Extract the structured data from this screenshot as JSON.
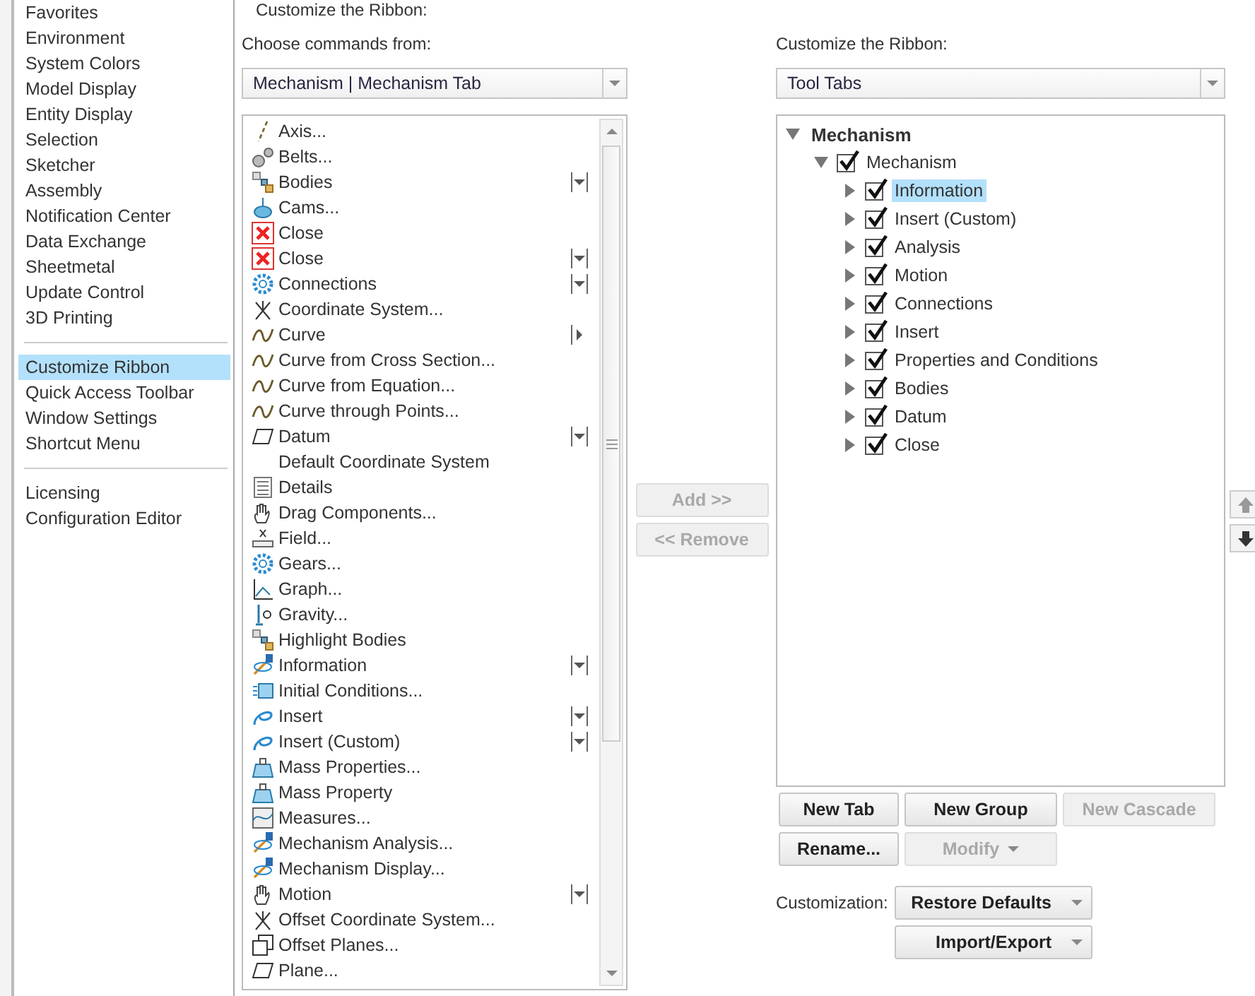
{
  "sidebar": {
    "groups": [
      {
        "items": [
          {
            "label": "Favorites",
            "selected": false
          },
          {
            "label": "Environment",
            "selected": false
          },
          {
            "label": "System Colors",
            "selected": false
          },
          {
            "label": "Model Display",
            "selected": false
          },
          {
            "label": "Entity Display",
            "selected": false
          },
          {
            "label": "Selection",
            "selected": false
          },
          {
            "label": "Sketcher",
            "selected": false
          },
          {
            "label": "Assembly",
            "selected": false
          },
          {
            "label": "Notification Center",
            "selected": false
          },
          {
            "label": "Data Exchange",
            "selected": false
          },
          {
            "label": "Sheetmetal",
            "selected": false
          },
          {
            "label": "Update Control",
            "selected": false
          },
          {
            "label": "3D Printing",
            "selected": false
          }
        ]
      },
      {
        "items": [
          {
            "label": "Customize Ribbon",
            "selected": true
          },
          {
            "label": "Quick Access Toolbar",
            "selected": false
          },
          {
            "label": "Window Settings",
            "selected": false
          },
          {
            "label": "Shortcut Menu",
            "selected": false
          }
        ]
      },
      {
        "items": [
          {
            "label": "Licensing",
            "selected": false
          },
          {
            "label": "Configuration Editor",
            "selected": false
          }
        ]
      }
    ]
  },
  "page_title": "Customize the Ribbon:",
  "commands": {
    "label": "Choose commands from:",
    "source": "Mechanism | Mechanism Tab",
    "items": [
      {
        "label": "Axis...",
        "dropdown": false,
        "cascade": false
      },
      {
        "label": "Belts...",
        "dropdown": false,
        "cascade": false
      },
      {
        "label": "Bodies",
        "dropdown": true,
        "cascade": false
      },
      {
        "label": "Cams...",
        "dropdown": false,
        "cascade": false
      },
      {
        "label": "Close",
        "dropdown": false,
        "cascade": false
      },
      {
        "label": "Close",
        "dropdown": true,
        "cascade": false
      },
      {
        "label": "Connections",
        "dropdown": true,
        "cascade": false
      },
      {
        "label": "Coordinate System...",
        "dropdown": false,
        "cascade": false
      },
      {
        "label": "Curve",
        "dropdown": false,
        "cascade": true
      },
      {
        "label": "Curve from Cross Section...",
        "dropdown": false,
        "cascade": false
      },
      {
        "label": "Curve from Equation...",
        "dropdown": false,
        "cascade": false
      },
      {
        "label": "Curve through Points...",
        "dropdown": false,
        "cascade": false
      },
      {
        "label": "Datum",
        "dropdown": true,
        "cascade": false
      },
      {
        "label": "Default Coordinate System",
        "dropdown": false,
        "cascade": false
      },
      {
        "label": "Details",
        "dropdown": false,
        "cascade": false
      },
      {
        "label": "Drag Components...",
        "dropdown": false,
        "cascade": false
      },
      {
        "label": "Field...",
        "dropdown": false,
        "cascade": false
      },
      {
        "label": "Gears...",
        "dropdown": false,
        "cascade": false
      },
      {
        "label": "Graph...",
        "dropdown": false,
        "cascade": false
      },
      {
        "label": "Gravity...",
        "dropdown": false,
        "cascade": false
      },
      {
        "label": "Highlight Bodies",
        "dropdown": false,
        "cascade": false
      },
      {
        "label": "Information",
        "dropdown": true,
        "cascade": false
      },
      {
        "label": "Initial Conditions...",
        "dropdown": false,
        "cascade": false
      },
      {
        "label": "Insert",
        "dropdown": true,
        "cascade": false
      },
      {
        "label": "Insert (Custom)",
        "dropdown": true,
        "cascade": false
      },
      {
        "label": "Mass Properties...",
        "dropdown": false,
        "cascade": false
      },
      {
        "label": "Mass Property",
        "dropdown": false,
        "cascade": false
      },
      {
        "label": "Measures...",
        "dropdown": false,
        "cascade": false
      },
      {
        "label": "Mechanism Analysis...",
        "dropdown": false,
        "cascade": false
      },
      {
        "label": "Mechanism Display...",
        "dropdown": false,
        "cascade": false
      },
      {
        "label": "Motion",
        "dropdown": true,
        "cascade": false
      },
      {
        "label": "Offset Coordinate System...",
        "dropdown": false,
        "cascade": false
      },
      {
        "label": "Offset Planes...",
        "dropdown": false,
        "cascade": false
      },
      {
        "label": "Plane...",
        "dropdown": false,
        "cascade": false
      }
    ]
  },
  "transfer_buttons": [
    {
      "label": "Add >>",
      "disabled": true
    },
    {
      "label": "<< Remove",
      "disabled": true
    }
  ],
  "ribbon": {
    "label": "Customize the Ribbon:",
    "source": "Tool Tabs",
    "tree": [
      {
        "label": "Mechanism",
        "expanded": true,
        "children": [
          {
            "label": "Mechanism",
            "checked": true,
            "expanded": true,
            "selected": false,
            "children": [
              {
                "label": "Information",
                "checked": true,
                "expanded": false,
                "selected": true
              },
              {
                "label": "Insert (Custom)",
                "checked": true,
                "expanded": false,
                "selected": false
              },
              {
                "label": "Analysis",
                "checked": true,
                "expanded": false,
                "selected": false
              },
              {
                "label": "Motion",
                "checked": true,
                "expanded": false,
                "selected": false
              },
              {
                "label": "Connections",
                "checked": true,
                "expanded": false,
                "selected": false
              },
              {
                "label": "Insert",
                "checked": true,
                "expanded": false,
                "selected": false
              },
              {
                "label": "Properties and Conditions",
                "checked": true,
                "expanded": false,
                "selected": false
              },
              {
                "label": "Bodies",
                "checked": true,
                "expanded": false,
                "selected": false
              },
              {
                "label": "Datum",
                "checked": true,
                "expanded": false,
                "selected": false
              },
              {
                "label": "Close",
                "checked": true,
                "expanded": false,
                "selected": false
              }
            ]
          }
        ]
      }
    ],
    "button_rows": [
      [
        {
          "label": "New Tab",
          "disabled": false,
          "dropdown": false
        },
        {
          "label": "New Group",
          "disabled": false,
          "dropdown": false
        },
        {
          "label": "New Cascade",
          "disabled": true,
          "dropdown": false
        }
      ],
      [
        {
          "label": "Rename...",
          "disabled": false,
          "dropdown": false
        },
        {
          "label": "Modify",
          "disabled": true,
          "dropdown": true
        }
      ]
    ],
    "customization_label": "Customization:",
    "customization_buttons": [
      {
        "label": "Restore Defaults",
        "disabled": false,
        "dropdown": true
      },
      {
        "label": "Import/Export",
        "disabled": false,
        "dropdown": true
      }
    ]
  }
}
